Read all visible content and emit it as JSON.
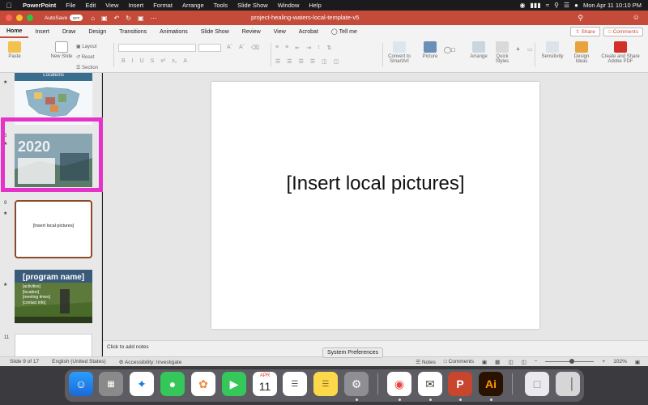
{
  "menubar": {
    "app": "PowerPoint",
    "items": [
      "File",
      "Edit",
      "View",
      "Insert",
      "Format",
      "Arrange",
      "Tools",
      "Slide Show",
      "Window",
      "Help"
    ],
    "clock": "Mon Apr 11  10:10 PM"
  },
  "titlebar": {
    "autosave_label": "AutoSave",
    "autosave_state": "OFF",
    "title": "project-healing-waters-local-template-v5"
  },
  "tabs": [
    "Home",
    "Insert",
    "Draw",
    "Design",
    "Transitions",
    "Animations",
    "Slide Show",
    "Review",
    "View",
    "Acrobat",
    "Tell me"
  ],
  "share_label": "Share",
  "comments_label": "Comments",
  "ribbon": {
    "paste": "Paste",
    "new_slide": "New Slide",
    "layout": "Layout",
    "reset": "Reset",
    "section": "Section",
    "convert": "Convert to SmartArt",
    "picture": "Picture",
    "arrange": "Arrange",
    "quick_styles": "Quick Styles",
    "sensitivity": "Sensitivity",
    "design_ideas": "Design Ideas",
    "create_share": "Create and Share Adobe PDF"
  },
  "thumbnails": {
    "map_head": "Locations",
    "n6": "6",
    "year": "2020",
    "n9": "9",
    "cur_text": "[Insert local pictures]",
    "prog_title": "[program name]",
    "prog_lines": "[activities]\n[location]\n[meeting times]\n[contact info]",
    "n11": "11"
  },
  "slide": {
    "text": "[Insert local pictures]"
  },
  "notes_placeholder": "Click to add notes",
  "status": {
    "slide_of": "Slide 9 of 17",
    "language": "English (United States)",
    "accessibility": "Accessibility: Investigate",
    "notes": "Notes",
    "comments": "Comments",
    "zoom": "102%"
  },
  "tooltip": "System Preferences",
  "dock": {
    "calendar_month": "APR",
    "calendar_day": "11",
    "ai": "Ai"
  }
}
